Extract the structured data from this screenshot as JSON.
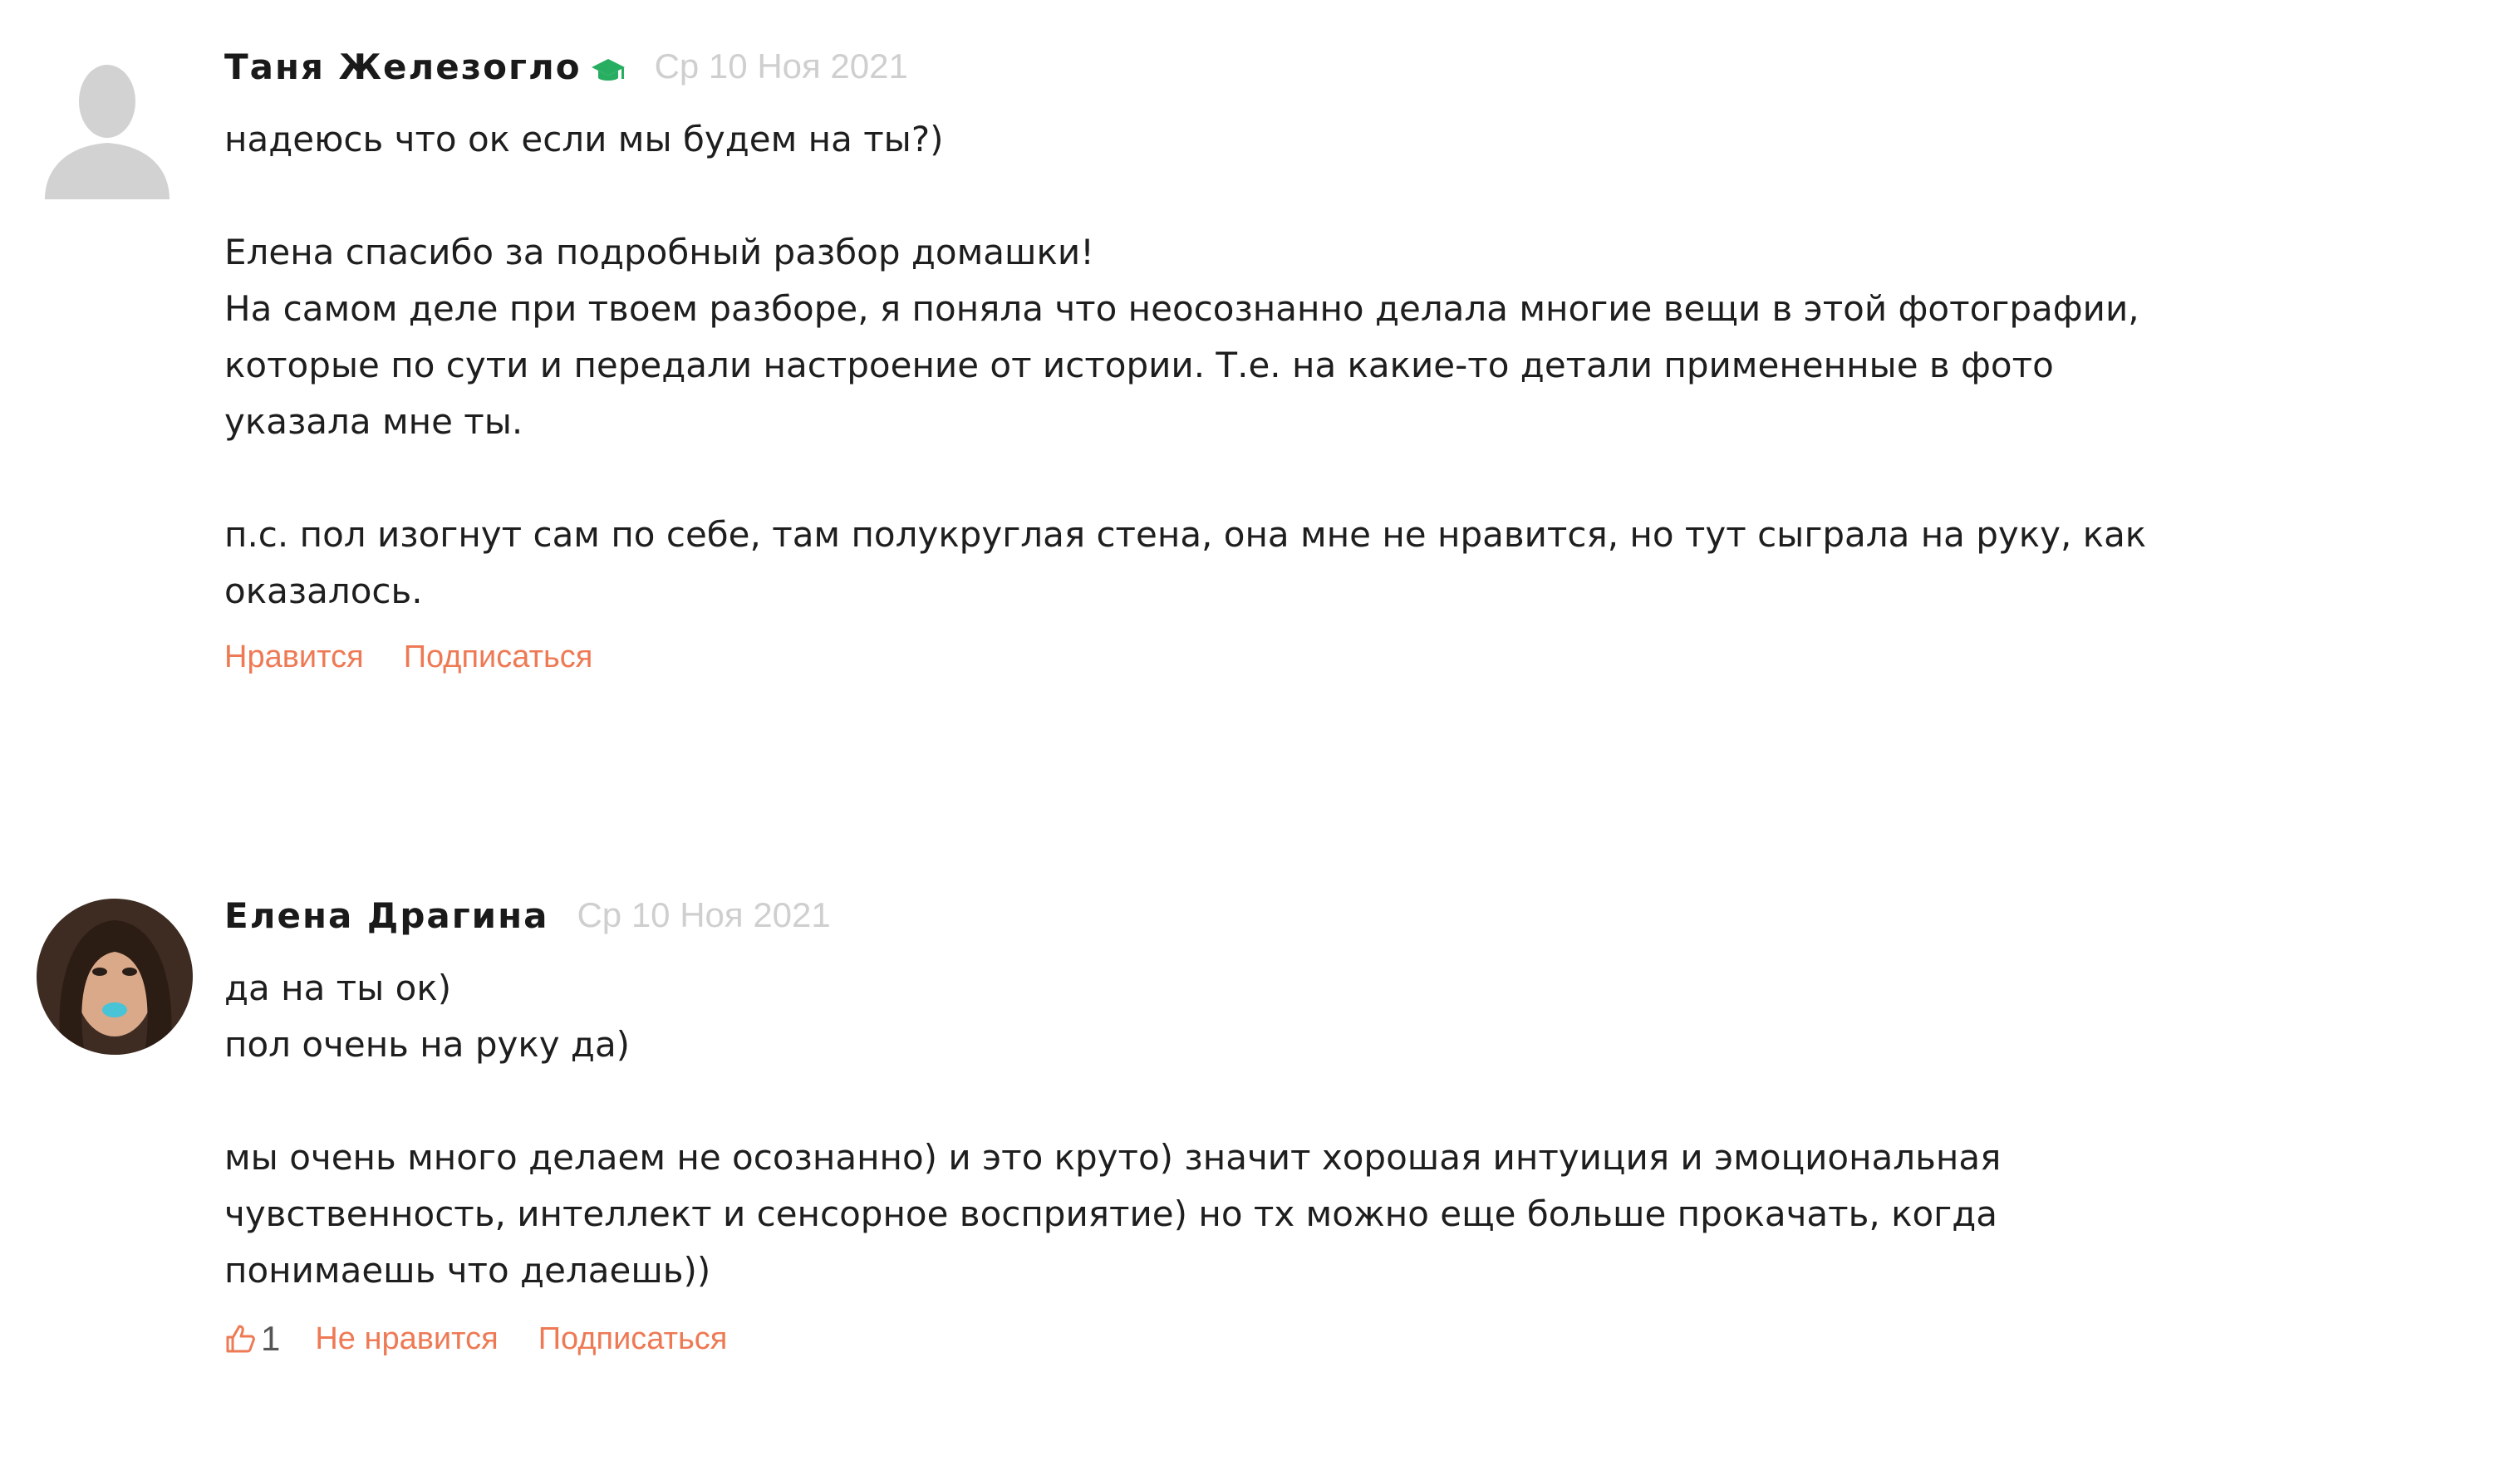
{
  "comments": [
    {
      "author": "Таня Железогло",
      "date": "Ср 10 Ноя 2021",
      "badge_icon": "graduation-cap-icon",
      "paragraphs": [
        [
          "надеюсь что ок если мы будем на ты?)"
        ],
        [
          "Елена спасибо за подробный разбор домашки!",
          "На самом деле при твоем разборе, я поняла что неосознанно делала многие вещи в этой фотографии,",
          "которые по сути и передали настроение от истории. Т.е. на какие-то детали примененные в фото",
          "указала мне ты."
        ],
        [
          "п.с. пол изогнут сам по себе, там полукруглая стена, она мне не нравится, но тут сыграла на руку, как",
          "оказалось."
        ]
      ],
      "actions": {
        "like_label": "Нравится",
        "subscribe_label": "Подписаться"
      }
    },
    {
      "author": "Елена Драгина",
      "date": "Ср 10 Ноя 2021",
      "paragraphs": [
        [
          "да на ты ок)",
          "пол очень на руку да)"
        ],
        [
          "мы очень много делаем не осознанно) и это круто) значит хорошая интуиция и эмоциональная",
          "чувственность, интеллект и сенсорное восприятие) но тх можно еще больше прокачать, когда",
          "понимаешь что делаешь))"
        ]
      ],
      "actions": {
        "like_count": "1",
        "unlike_label": "Не нравится",
        "subscribe_label": "Подписаться"
      }
    }
  ],
  "colors": {
    "accent": "#ee7a55",
    "badge": "#27ae60",
    "date": "#cfcfcf"
  }
}
